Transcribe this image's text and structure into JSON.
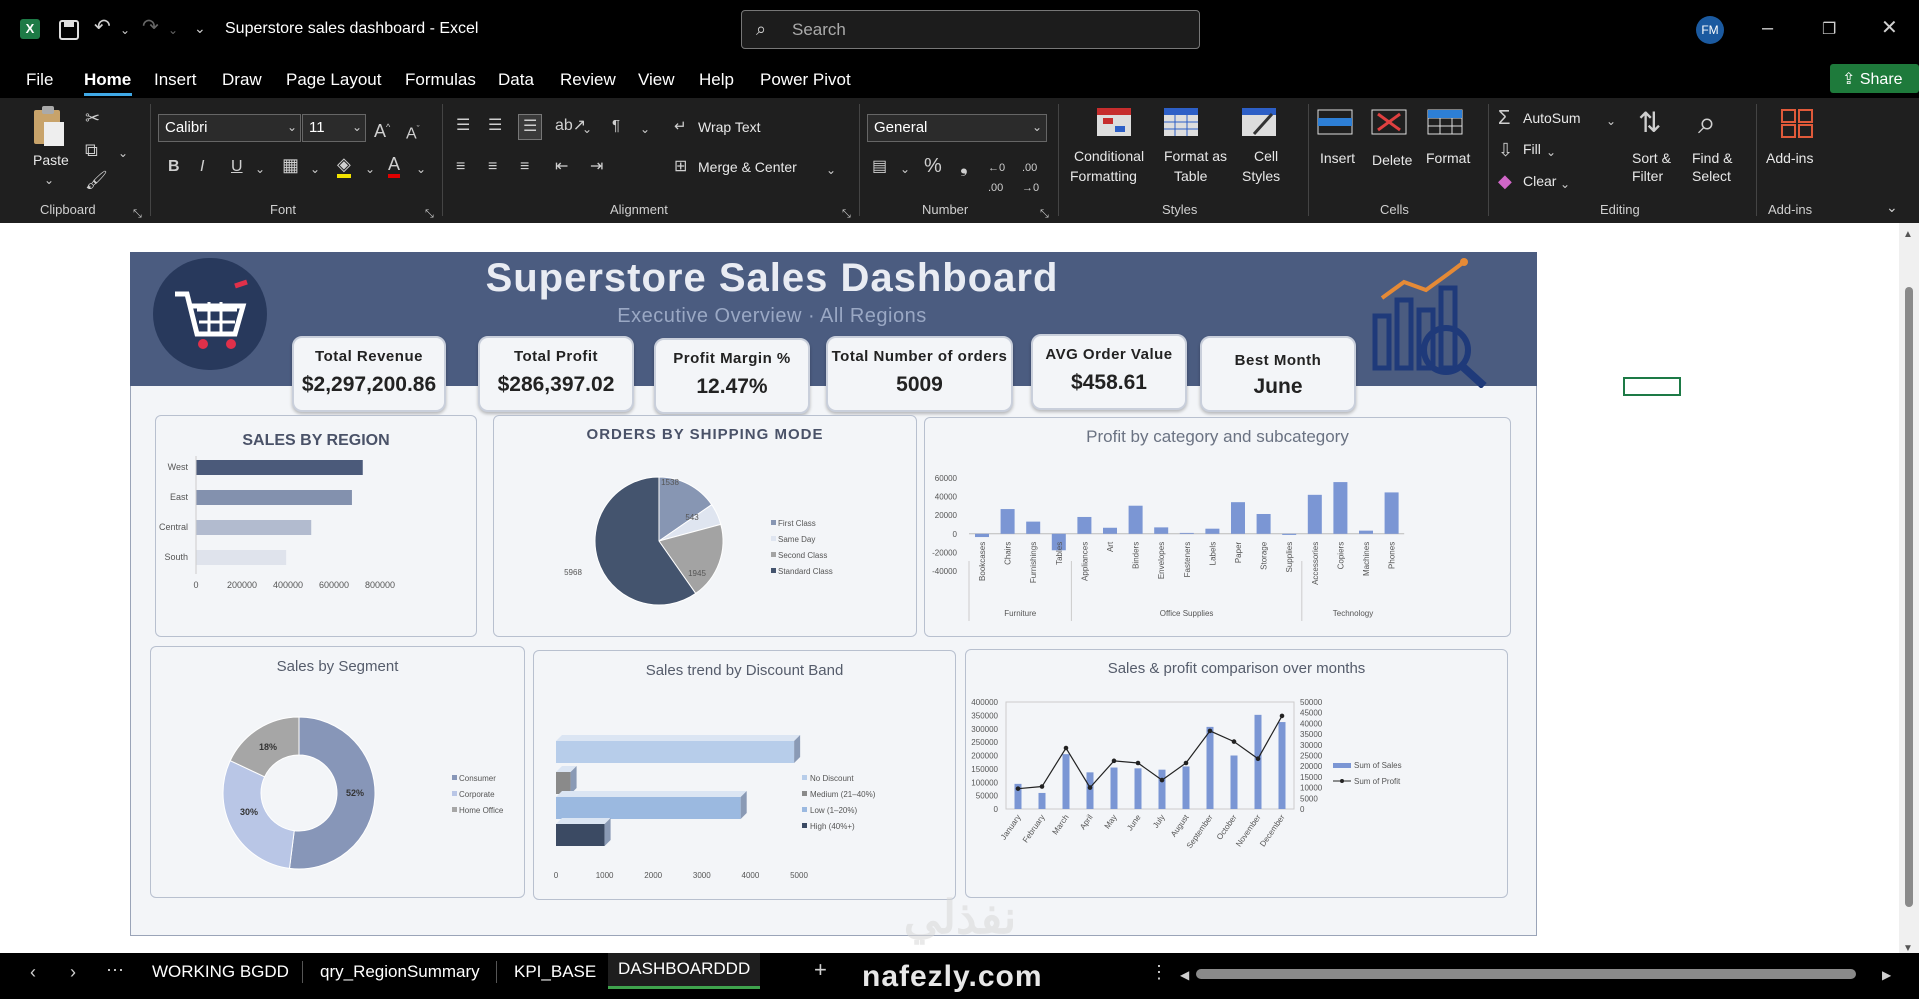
{
  "window": {
    "title": "Superstore sales dashboard  -  Excel",
    "search_placeholder": "Search",
    "avatar": "FM",
    "share_label": "Share"
  },
  "menu": [
    "File",
    "Home",
    "Insert",
    "Draw",
    "Page Layout",
    "Formulas",
    "Data",
    "Review",
    "View",
    "Help",
    "Power Pivot"
  ],
  "ribbon": {
    "paste": "Paste",
    "clipboard": "Clipboard",
    "font_name": "Calibri",
    "font_size": "11",
    "font": "Font",
    "wrap_text": "Wrap Text",
    "merge_center": "Merge & Center",
    "alignment": "Alignment",
    "number_format": "General",
    "number": "Number",
    "conditional_1": "Conditional",
    "conditional_2": "Formatting",
    "format_table_1": "Format as",
    "format_table_2": "Table",
    "cell_styles_1": "Cell",
    "cell_styles_2": "Styles",
    "styles": "Styles",
    "insert": "Insert",
    "delete": "Delete",
    "format": "Format",
    "cells": "Cells",
    "autosum": "AutoSum",
    "fill": "Fill",
    "clear": "Clear",
    "sort_1": "Sort &",
    "sort_2": "Filter",
    "find_1": "Find &",
    "find_2": "Select",
    "editing": "Editing",
    "addins": "Add-ins",
    "addins_group": "Add-ins"
  },
  "dashboard": {
    "title": "Superstore Sales Dashboard",
    "subtitle": "Executive Overview · All Regions",
    "kpis": [
      {
        "label": "Total Revenue",
        "value": "$2,297,200.86"
      },
      {
        "label": "Total Profit",
        "value": "$286,397.02"
      },
      {
        "label": "Profit Margin %",
        "value": "12.47%"
      },
      {
        "label": "Total Number of orders",
        "value": "5009"
      },
      {
        "label": "AVG Order Value",
        "value": "$458.61"
      },
      {
        "label": "Best Month",
        "value": "June"
      }
    ]
  },
  "chart_data": [
    {
      "type": "bar",
      "title": "SALES BY REGION",
      "orientation": "horizontal",
      "categories": [
        "West",
        "East",
        "Central",
        "South"
      ],
      "values": [
        725000,
        678000,
        501000,
        392000
      ],
      "xticks": [
        "0",
        "200000",
        "400000",
        "600000",
        "800000"
      ],
      "xlim": [
        0,
        800000
      ]
    },
    {
      "type": "pie",
      "title": "ORDERS BY SHIPPING MODE",
      "categories": [
        "First Class",
        "Same Day",
        "Second Class",
        "Standard Class"
      ],
      "values": [
        1538,
        543,
        1945,
        5968
      ],
      "colors": [
        "#8796b3",
        "#dfe5f0",
        "#a3a3a3",
        "#44546e"
      ]
    },
    {
      "type": "bar",
      "title": "Profit by category and subcategory",
      "categories": [
        "Bookcases",
        "Chairs",
        "Furnishings",
        "Tables",
        "Appliances",
        "Art",
        "Binders",
        "Envelopes",
        "Fasteners",
        "Labels",
        "Paper",
        "Storage",
        "Supplies",
        "Accessories",
        "Copiers",
        "Machines",
        "Phones"
      ],
      "groups": [
        {
          "name": "Furniture",
          "span": 4
        },
        {
          "name": "Office Supplies",
          "span": 9
        },
        {
          "name": "Technology",
          "span": 4
        }
      ],
      "values": [
        -3500,
        26600,
        13100,
        -17700,
        18100,
        6500,
        30200,
        6900,
        950,
        5500,
        34000,
        21300,
        -1200,
        41900,
        55600,
        3400,
        44500
      ],
      "yticks": [
        "60000",
        "40000",
        "20000",
        "0",
        "-20000",
        "-40000"
      ],
      "ylim": [
        -40000,
        60000
      ]
    },
    {
      "type": "pie",
      "title": "Sales by Segment",
      "categories": [
        "Consumer",
        "Corporate",
        "Home Office"
      ],
      "values": [
        52,
        30,
        18
      ],
      "labels": [
        "52%",
        "30%",
        "18%"
      ],
      "colors": [
        "#8796b8",
        "#b9c6e6",
        "#a6a6a6"
      ]
    },
    {
      "type": "bar",
      "title": "Sales trend by Discount Band",
      "orientation": "horizontal",
      "categories": [
        "No Discount",
        "Medium (21–40%)",
        "Low (1–20%)",
        "High (40%+)"
      ],
      "values": [
        4900,
        300,
        3800,
        1000
      ],
      "colors": [
        "#b7cdea",
        "#8a8a8a",
        "#9bb9e0",
        "#3b4a63"
      ],
      "xticks": [
        "0",
        "1000",
        "2000",
        "3000",
        "4000",
        "5000"
      ],
      "xlim": [
        0,
        5000
      ]
    },
    {
      "type": "bar",
      "title": "Sales & profit comparison over months",
      "categories": [
        "January",
        "February",
        "March",
        "April",
        "May",
        "June",
        "July",
        "August",
        "September",
        "October",
        "November",
        "December"
      ],
      "series": [
        {
          "name": "Sum of Sales",
          "values": [
            94000,
            60000,
            205000,
            137000,
            155000,
            152000,
            147000,
            159000,
            307000,
            200000,
            352000,
            325000
          ]
        },
        {
          "name": "Sum of Profit",
          "values": [
            9500,
            10500,
            28500,
            10000,
            22500,
            21500,
            13500,
            21500,
            36500,
            31500,
            23500,
            43500
          ]
        }
      ],
      "yticks_left": [
        "400000",
        "350000",
        "300000",
        "250000",
        "200000",
        "150000",
        "100000",
        "50000",
        "0"
      ],
      "yticks_right": [
        "50000",
        "45000",
        "40000",
        "35000",
        "30000",
        "25000",
        "20000",
        "15000",
        "10000",
        "5000",
        "0"
      ],
      "ylim_left": [
        0,
        400000
      ],
      "ylim_right": [
        0,
        50000
      ]
    }
  ],
  "sheets": [
    "WORKING BGDD",
    "qry_RegionSummary",
    "KPI_BASE",
    "DASHBOARDDD"
  ],
  "active_sheet": "DASHBOARDDD",
  "watermark": "nafezly.com"
}
